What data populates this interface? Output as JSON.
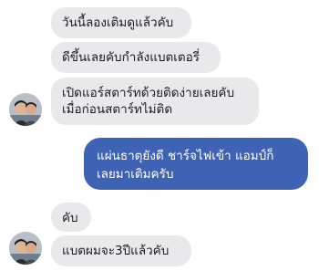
{
  "messages": {
    "m1": "วันนี้ลองเติมดูแล้วคับ",
    "m2": "ดีขึ้นเลยคับกำลังแบตเตอรี่",
    "m3_line1": "เปิดแอร์สตาร์ทด้วยติดง่ายเลยคับ",
    "m3_line2": "เมื่อก่อนสตาร์ทไม่ติด",
    "m4_line1": "แผ่นธาตุยังดี ชาร์จไฟเข้า แอมป์ก็",
    "m4_line2": "เลยมาเติมครับ",
    "m5": "คับ",
    "m6": "แบตผมจะ3ปีแล้วคับ"
  },
  "colors": {
    "incoming_bubble": "#e9e9eb",
    "outgoing_bubble": "#3e63b5"
  },
  "icons": {
    "avatar": "user-avatar-photo"
  }
}
